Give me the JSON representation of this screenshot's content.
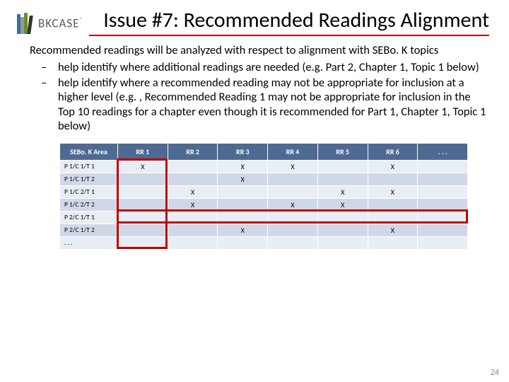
{
  "logo": {
    "text_main": "BKCASE",
    "text_mark": "`"
  },
  "title": "Issue #7: Recommended Readings Alignment",
  "intro": "Recommended readings will be analyzed with respect to alignment with SEBo. K topics",
  "bullets": [
    "help identify where additional readings are needed (e.g. Part 2, Chapter 1, Topic 1 below)",
    "help identify where a recommended reading may not be appropriate for inclusion at a higher level (e.g. , Recommended Reading 1 may not be appropriate for inclusion in the Top 10 readings for a chapter even though it is recommended for Part 1, Chapter 1, Topic 1 below)"
  ],
  "table": {
    "headers": [
      "SEBo. K Area",
      "RR 1",
      "RR 2",
      "RR 3",
      "RR 4",
      "RR 5",
      "RR 6",
      ". . ."
    ],
    "rows": [
      {
        "area": "P 1/C 1/T 1",
        "marks": [
          "X",
          "",
          "X",
          "X",
          "",
          "X",
          ""
        ]
      },
      {
        "area": "P 1/C 1/T 2",
        "marks": [
          "",
          "",
          "X",
          "",
          "",
          "",
          ""
        ]
      },
      {
        "area": "P 1/C 2/T 1",
        "marks": [
          "",
          "X",
          "",
          "",
          "X",
          "X",
          ""
        ]
      },
      {
        "area": "P 1/C 2/T 2",
        "marks": [
          "",
          "X",
          "",
          "X",
          "X",
          "",
          ""
        ]
      },
      {
        "area": "P 2/C 1/T 1",
        "marks": [
          "",
          "",
          "",
          "",
          "",
          "",
          ""
        ]
      },
      {
        "area": "P 2/C 1/T 2",
        "marks": [
          "",
          "",
          "X",
          "",
          "",
          "X",
          ""
        ]
      },
      {
        "area": ". . .",
        "marks": [
          "",
          "",
          "",
          "",
          "",
          "",
          ""
        ]
      }
    ]
  },
  "slide_number": "24"
}
